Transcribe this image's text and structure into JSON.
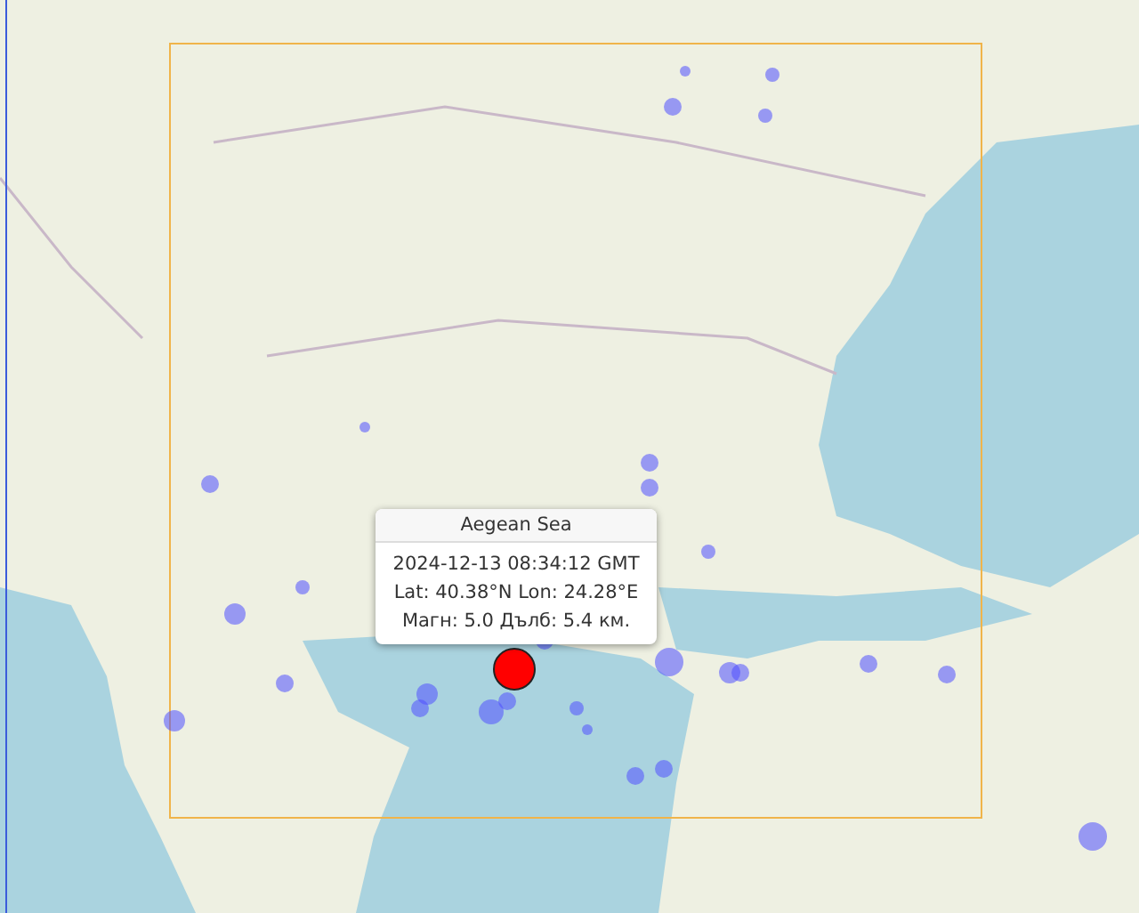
{
  "popup": {
    "title": "Aegean Sea",
    "lines": [
      "2024-12-13 08:34:12 GMT",
      "Lat: 40.38°N Lon: 24.28°E",
      "Магн: 5.0 Дълб: 5.4 км."
    ]
  }
}
